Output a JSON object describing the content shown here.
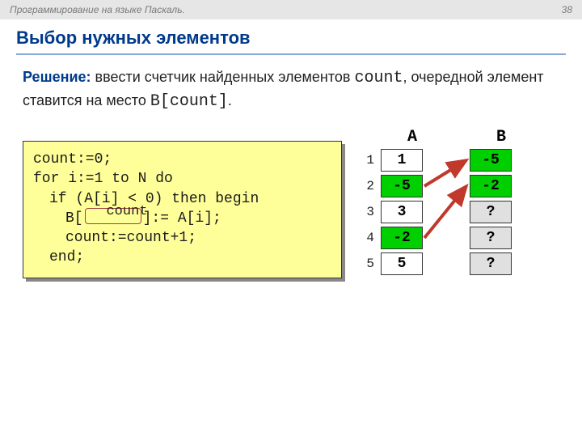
{
  "header": {
    "course": "Программирование на языке Паскаль.",
    "page": "38"
  },
  "title": "Выбор нужных элементов",
  "solution": {
    "label": "Решение:",
    "text1": " ввести счетчик найденных элементов ",
    "code1": "count",
    "text2": ", очередной элемент ставится на место ",
    "code2": "B[count]",
    "text3": "."
  },
  "code": {
    "l1": "count:=0;",
    "l2": "for i:=1 to N do",
    "l3": "if (A[i] < 0) then begin",
    "l4a": "B[",
    "l4b": "]:= A[i];",
    "l5": "count:=count+1;",
    "l6": "end;",
    "blank_label": "count"
  },
  "arrays": {
    "labelA": "A",
    "labelB": "B",
    "rows": [
      {
        "idx": "1",
        "a": "1",
        "aGreen": false,
        "b": "-5",
        "bGreen": true,
        "bGray": false
      },
      {
        "idx": "2",
        "a": "-5",
        "aGreen": true,
        "b": "-2",
        "bGreen": true,
        "bGray": false
      },
      {
        "idx": "3",
        "a": "3",
        "aGreen": false,
        "b": "?",
        "bGreen": false,
        "bGray": true
      },
      {
        "idx": "4",
        "a": "-2",
        "aGreen": true,
        "b": "?",
        "bGreen": false,
        "bGray": true
      },
      {
        "idx": "5",
        "a": "5",
        "aGreen": false,
        "b": "?",
        "bGreen": false,
        "bGray": true
      }
    ]
  }
}
